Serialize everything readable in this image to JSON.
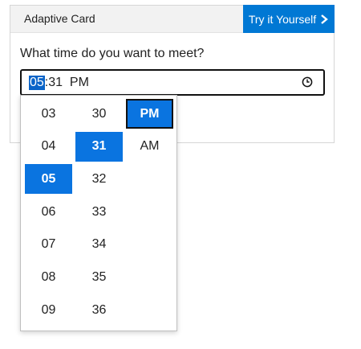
{
  "card": {
    "title": "Adaptive Card",
    "try_button": "Try it Yourself",
    "prompt": "What time do you want to meet?"
  },
  "time_input": {
    "hour": "05",
    "rest": ":31  PM"
  },
  "picker": {
    "hours": [
      "03",
      "04",
      "05",
      "06",
      "07",
      "08",
      "09"
    ],
    "minutes": [
      "30",
      "31",
      "32",
      "33",
      "34",
      "35",
      "36"
    ],
    "periods": [
      "PM",
      "AM"
    ],
    "selected_hour": "05",
    "selected_minute": "31",
    "selected_period": "PM"
  },
  "colors": {
    "accent": "#0078d4",
    "selection": "#0a74e0"
  }
}
